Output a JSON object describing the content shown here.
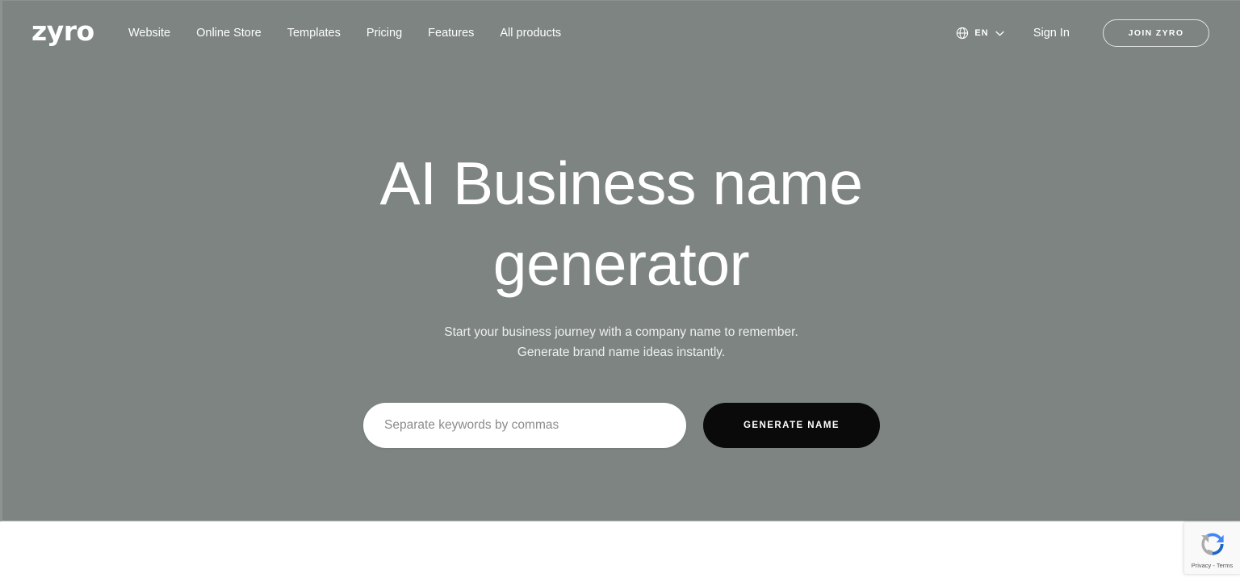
{
  "brand": {
    "logo_text": "zyro",
    "accent_color": "#7d8482",
    "button_color": "#0a0a0a",
    "text_color": "#ffffff"
  },
  "header": {
    "nav": [
      {
        "label": "Website"
      },
      {
        "label": "Online Store"
      },
      {
        "label": "Templates"
      },
      {
        "label": "Pricing"
      },
      {
        "label": "Features"
      },
      {
        "label": "All products"
      }
    ],
    "language": {
      "code": "EN",
      "icon": "globe-icon",
      "chevron": "chevron-down-icon"
    },
    "sign_in_label": "Sign In",
    "join_label": "JOIN ZYRO"
  },
  "hero": {
    "title": "AI Business name\ngenerator",
    "subtitle": "Start your business journey with a company name to remember.\nGenerate brand name ideas instantly.",
    "form": {
      "input_placeholder": "Separate keywords by commas",
      "input_value": "",
      "submit_label": "GENERATE NAME"
    }
  },
  "recaptcha": {
    "privacy_terms": "Privacy - Terms",
    "icon": "recaptcha-icon"
  }
}
